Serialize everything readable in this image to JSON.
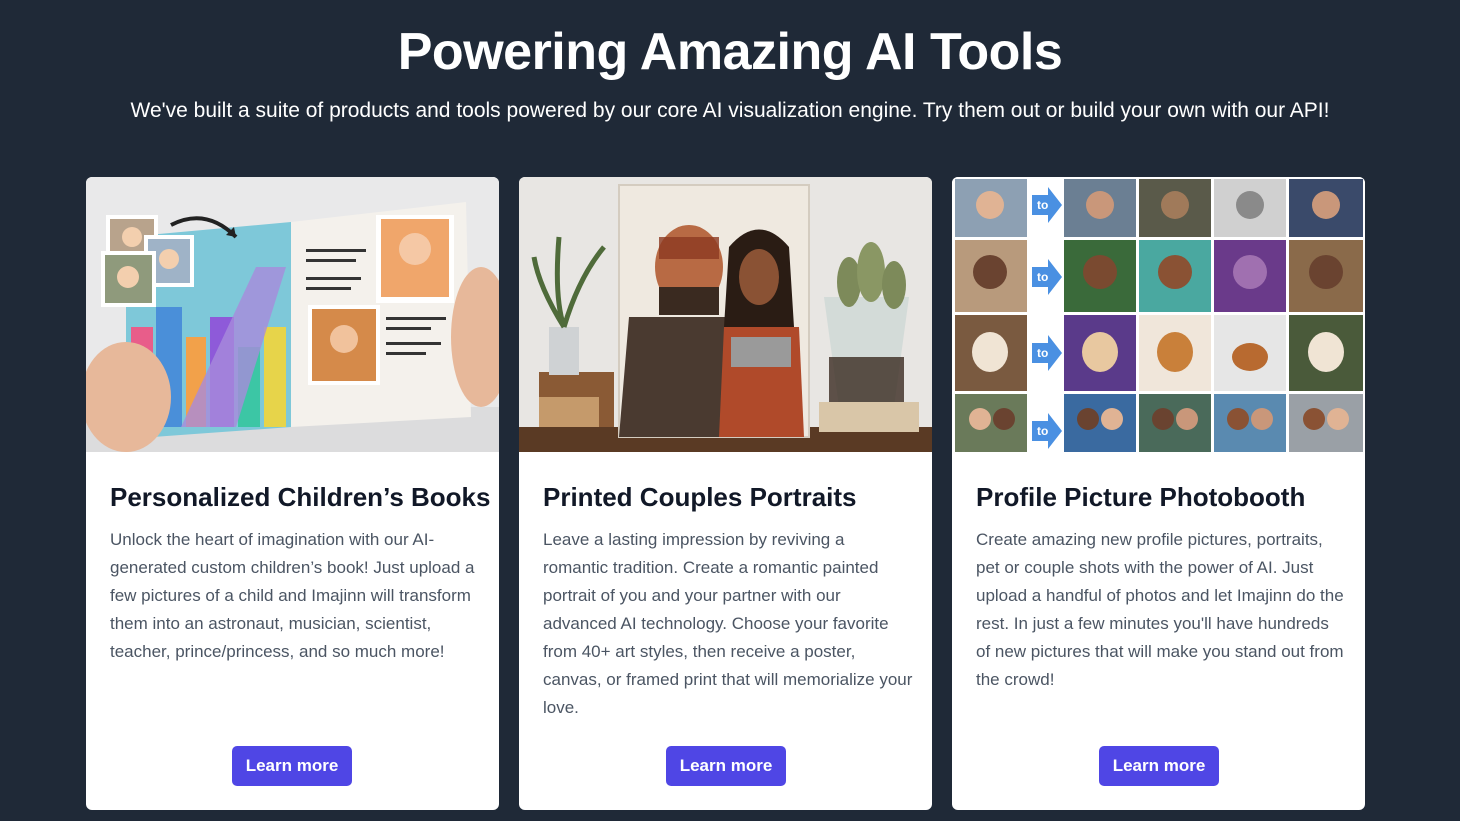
{
  "header": {
    "title": "Powering Amazing AI Tools",
    "subtitle": "We've built a suite of products and tools powered by our core AI visualization engine. Try them out or build your own with our API!"
  },
  "cards": [
    {
      "title": "Personalized Children’s Books",
      "description": "Unlock the heart of imagination with our AI-generated custom children’s book! Just upload a few pictures of a child and Imajinn will transform them into an astronaut, musician, scientist, teacher, prince/princess, and so much more!",
      "button_label": "Learn more",
      "image_alt": "book-photo"
    },
    {
      "title": "Printed Couples Portraits",
      "description": "Leave a lasting impression by reviving a romantic tradition. Create a romantic painted portrait of you and your partner with our advanced AI technology. Choose your favorite from 40+ art styles, then receive a poster, canvas, or framed print that will memorialize your love.",
      "button_label": "Learn more",
      "image_alt": "portrait-photo"
    },
    {
      "title": "Profile Picture Photobooth",
      "description": "Create amazing new profile pictures, portraits, pet or couple shots with the power of AI. Just upload a handful of photos and let Imajinn do the rest. In just a few minutes you'll have hundreds of new pictures that will make you stand out from the crowd!",
      "button_label": "Learn more",
      "image_alt": "photobooth-grid",
      "arrow_label": "to"
    }
  ],
  "colors": {
    "background": "#1f2937",
    "button": "#4f46e5",
    "card": "#ffffff",
    "title_text": "#111827",
    "body_text": "#4b5563"
  }
}
